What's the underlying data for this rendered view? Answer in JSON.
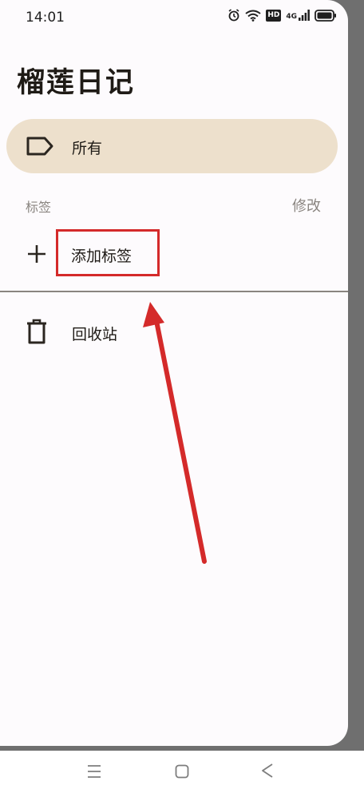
{
  "status_bar": {
    "time": "14:01",
    "icons": [
      "alarm-icon",
      "wifi-icon",
      "hd-badge",
      "signal-4g-icon",
      "battery-icon"
    ],
    "hd_label": "HD",
    "network_label": "4G"
  },
  "app": {
    "title": "榴莲日记"
  },
  "drawer": {
    "all_item": {
      "label": "所有",
      "icon": "tag-icon"
    },
    "tags_section": {
      "label": "标签",
      "edit_label": "修改"
    },
    "add_tag": {
      "label": "添加标签",
      "icon": "plus-icon"
    },
    "trash": {
      "label": "回收站",
      "icon": "trash-icon"
    }
  },
  "colors": {
    "selected_bg": "#ede0cc",
    "drawer_bg": "#fdfbfd",
    "scrim": "#6f6f6f",
    "annotation_red": "#d42a2a",
    "muted_text": "#8a8580"
  },
  "nav_bar": {
    "icons": [
      "menu-icon",
      "home-icon",
      "back-icon"
    ]
  }
}
